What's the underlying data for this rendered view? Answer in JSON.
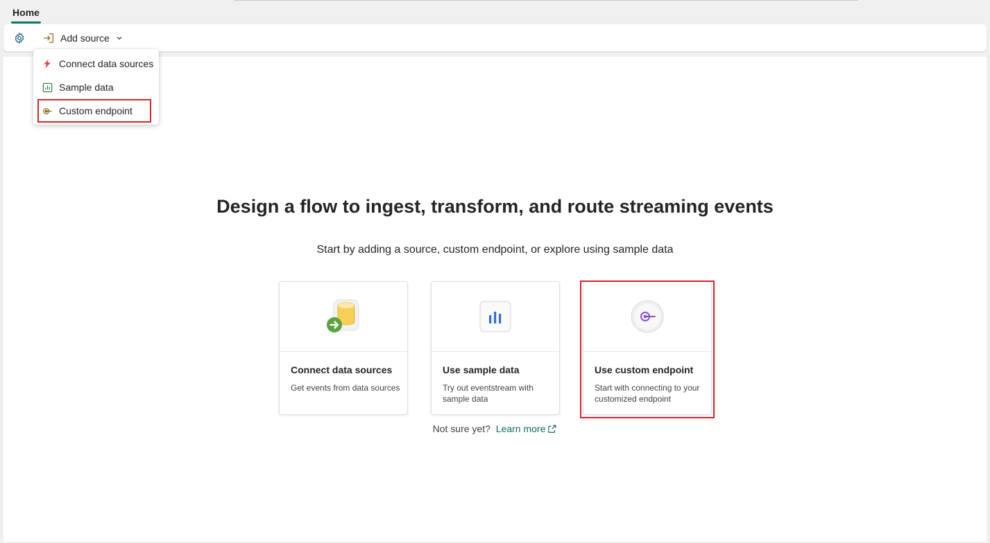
{
  "tabs": {
    "home_label": "Home"
  },
  "toolbar": {
    "settings_icon": "gear-icon",
    "add_source_label": "Add source"
  },
  "dropdown": {
    "items": [
      {
        "label": "Connect data sources",
        "icon": "lightning-icon"
      },
      {
        "label": "Sample data",
        "icon": "chart-icon"
      },
      {
        "label": "Custom endpoint",
        "icon": "endpoint-icon"
      }
    ]
  },
  "hero": {
    "title": "Design a flow to ingest, transform, and route streaming events",
    "subtitle": "Start by adding a source, custom endpoint, or explore using sample data"
  },
  "cards": [
    {
      "title": "Connect data sources",
      "desc": "Get events from data sources",
      "icon": "database-arrow-icon"
    },
    {
      "title": "Use sample data",
      "desc": "Try out eventstream with sample data",
      "icon": "bar-chart-icon"
    },
    {
      "title": "Use custom endpoint",
      "desc": "Start with connecting to your customized endpoint",
      "icon": "custom-endpoint-icon"
    }
  ],
  "footer": {
    "not_sure": "Not sure yet?",
    "learn_more": "Learn more"
  },
  "colors": {
    "accent": "#117865",
    "link": "#0f6c5d",
    "highlight": "#d7232d"
  }
}
